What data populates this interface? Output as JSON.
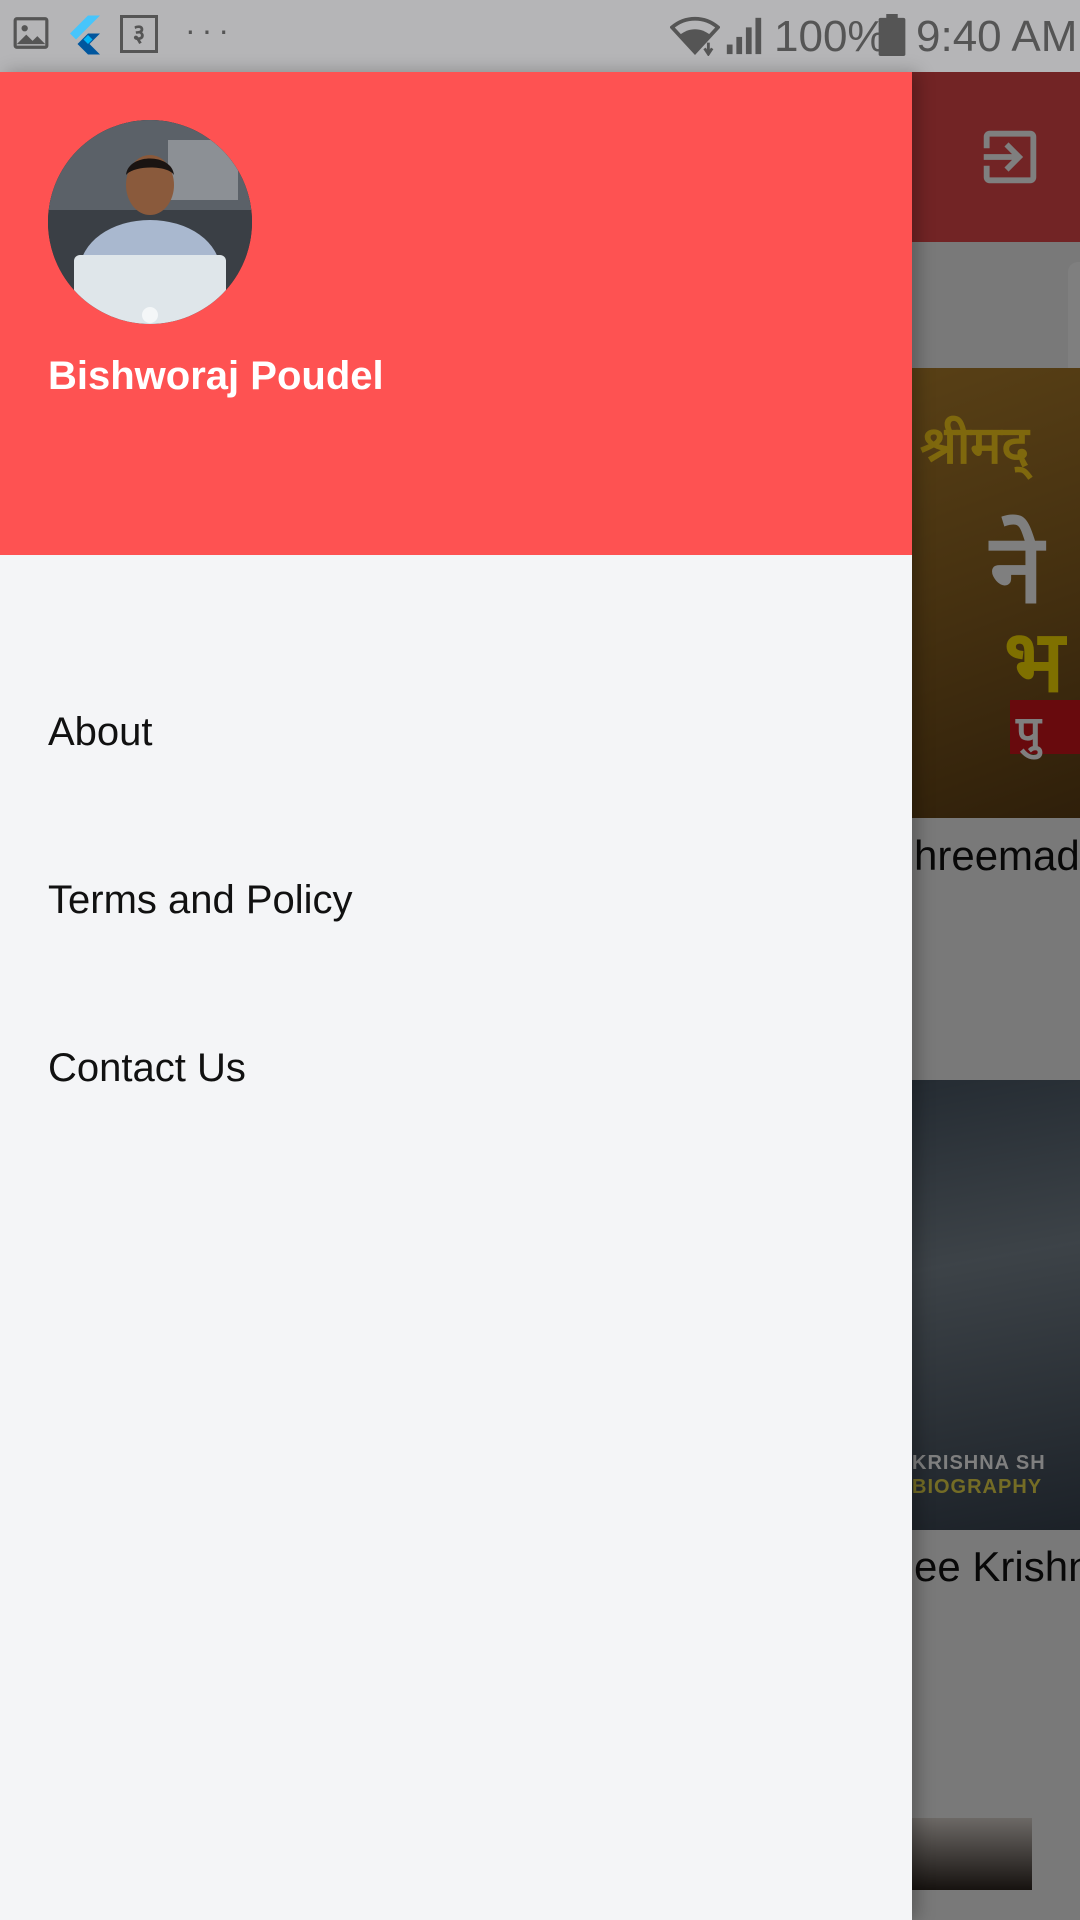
{
  "status_bar": {
    "icons": [
      "gallery-icon",
      "flutter-icon",
      "notification-box-icon",
      "more-dots-icon",
      "wifi-icon",
      "signal-icon",
      "battery-icon"
    ],
    "box_glyph": "३",
    "dots": "···",
    "battery": "100%",
    "time": "9:40 AM"
  },
  "drawer": {
    "header": {
      "user_name": "Bishworaj Poudel",
      "background_color": "#fe5252"
    },
    "items": [
      {
        "label": "About"
      },
      {
        "label": "Terms and Policy"
      },
      {
        "label": "Contact Us"
      }
    ]
  },
  "background_app": {
    "toolbar_icon": "exit-icon",
    "card_1": {
      "overlay_lines": [
        "श्रीमद्",
        "ने",
        "भ",
        "पु"
      ],
      "title": "hreemad"
    },
    "card_2": {
      "overlay_lines": [
        "KRISHNA SH",
        "BIOGRAPHY"
      ],
      "title": "ee Krishn"
    }
  }
}
